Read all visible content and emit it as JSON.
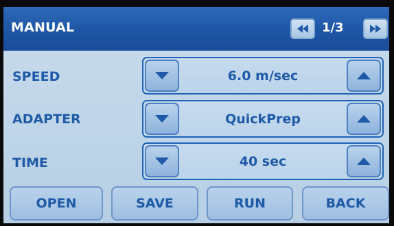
{
  "header": {
    "title": "MANUAL",
    "page_indicator": "1/3",
    "prev_icon": "rewind-icon",
    "next_icon": "fast-forward-icon"
  },
  "rows": [
    {
      "label": "SPEED",
      "value": "6.0 m/sec"
    },
    {
      "label": "ADAPTER",
      "value": "QuickPrep"
    },
    {
      "label": "TIME",
      "value": "40 sec"
    }
  ],
  "buttons": {
    "open": "OPEN",
    "save": "SAVE",
    "run": "RUN",
    "back": "BACK"
  },
  "colors": {
    "header_bg": "#1e55a5",
    "screen_bg": "#c1d6ea",
    "text_accent": "#1e5aa8",
    "field_border": "#1e62b8"
  }
}
